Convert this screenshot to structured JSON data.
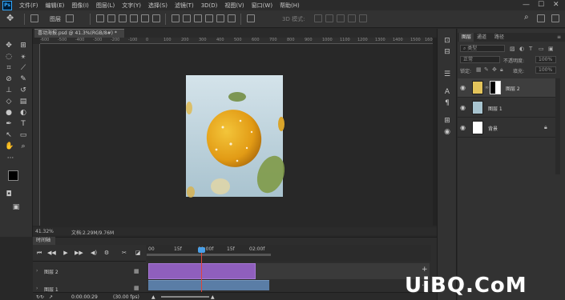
{
  "app": {
    "logo_text": "Ps"
  },
  "menu": [
    "文件(F)",
    "编辑(E)",
    "图像(I)",
    "图层(L)",
    "文字(Y)",
    "选择(S)",
    "滤镜(T)",
    "3D(D)",
    "视图(V)",
    "窗口(W)",
    "帮助(H)"
  ],
  "window_controls": {
    "minimize": "—",
    "maximize": "☐",
    "close": "✕"
  },
  "options_bar": {
    "auto_select": "图层",
    "mode_3d": "3D 模式:"
  },
  "document": {
    "tab_title": "喜动海报.psd @ 41.3%(RGB/8#) *",
    "ruler_marks": [
      "-600",
      "-500",
      "-400",
      "-300",
      "-200",
      "-100",
      "0",
      "100",
      "200",
      "300",
      "400",
      "500",
      "600",
      "700",
      "800",
      "900",
      "1000",
      "1100",
      "1200",
      "1300",
      "1400",
      "1500",
      "1600"
    ],
    "zoom": "41.32%",
    "doc_info": "文档:2.29M/9.76M"
  },
  "timeline": {
    "tab_label": "时间轴",
    "ruler_labels": [
      "00",
      "15f",
      "01:00f",
      "15f",
      "02:00f"
    ],
    "tracks": [
      "图层 2",
      "图层 1"
    ],
    "current_time": "0:00:00:29",
    "fps": "(30.00 fps)"
  },
  "layers_panel": {
    "tabs": [
      "图层",
      "通道",
      "路径"
    ],
    "active_tab": "图层",
    "filter_kind": "类型",
    "blend_mode": "正常",
    "opacity_label": "不透明度:",
    "opacity_value": "100%",
    "lock_label": "锁定:",
    "fill_label": "填充:",
    "fill_value": "100%",
    "layers": [
      {
        "name": "图层 2",
        "visible": true,
        "has_mask": true
      },
      {
        "name": "图层 1",
        "visible": true,
        "has_mask": false
      },
      {
        "name": "背景",
        "visible": true,
        "locked": true
      }
    ]
  },
  "watermark": "UiBQ.CoM",
  "colors": {
    "clip_purple": "#8f5fbd",
    "clip_blue": "#5a7da6",
    "playhead": "#e0453a",
    "lemon": "#e5a51c",
    "lime": "#8a9e4e",
    "image_bg": "#bcd2dc"
  }
}
